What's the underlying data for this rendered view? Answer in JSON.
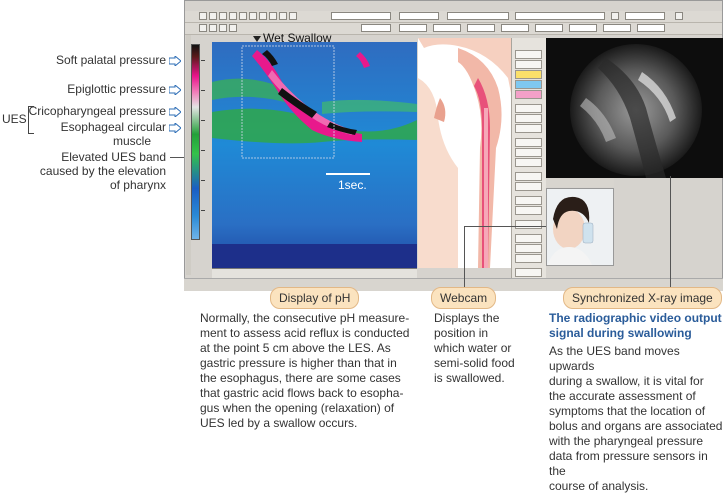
{
  "annotations": {
    "soft_palatal": "Soft palatal pressure",
    "epiglottic": "Epiglottic pressure",
    "ues_label": "UES",
    "cricopharyngeal": "Cricopharyngeal pressure",
    "esophageal_line1": "Esophageal circular",
    "esophageal_line2": "muscle",
    "elevated_line1": "Elevated UES band",
    "elevated_line2": "caused by the elevation",
    "elevated_line3": "of pharynx"
  },
  "topography": {
    "title": "Wet Swallow",
    "time_scale": "1sec."
  },
  "tags": {
    "ph": "Display of pH",
    "webcam": "Webcam",
    "xray": "Synchronized X-ray image"
  },
  "descriptions": {
    "ph": [
      "Normally, the consecutive pH measure-",
      "ment to assess acid reflux is conducted",
      "at the point 5 cm above the LES. As",
      "gastric pressure is higher than that in",
      "the esophagus, there are some cases",
      "that gastric acid flows back to esopha-",
      "gus when the opening (relaxation) of",
      "UES led by a swallow occurs."
    ],
    "webcam": [
      "Displays the",
      "position in",
      "which water or",
      "semi-solid food",
      "is swallowed."
    ],
    "xray_heading": [
      "The radiographic video output",
      "signal during swallowing"
    ],
    "xray": [
      "As the UES band moves upwards",
      "during a swallow, it is vital for",
      "the accurate assessment of",
      "symptoms that the location of",
      "bolus and organs are associated",
      "with the pharyngeal pressure",
      "data from pressure sensors in the",
      "course of analysis."
    ]
  },
  "colors": {
    "tag_fill": "#fbe3bf",
    "tag_border": "#e2b886",
    "heading_blue": "#2a5c9a",
    "arrow_blue": "#2b6cb5",
    "topo_blue": "#2a66b6"
  }
}
